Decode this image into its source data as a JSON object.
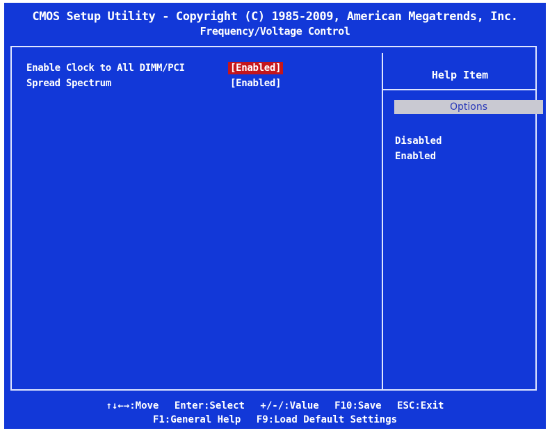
{
  "header": {
    "title": "CMOS Setup Utility - Copyright (C) 1985-2009, American Megatrends, Inc.",
    "subtitle": "Frequency/Voltage Control"
  },
  "settings": [
    {
      "label": "Enable Clock to All DIMM/PCI",
      "value": "[Enabled]",
      "selected": true
    },
    {
      "label": "Spread Spectrum",
      "value": "[Enabled]",
      "selected": false
    }
  ],
  "help": {
    "title": "Help Item",
    "options_header": "Options",
    "options": [
      "Disabled",
      "Enabled"
    ]
  },
  "footer": {
    "row1": [
      {
        "key": "↑↓←→",
        "action": ":Move"
      },
      {
        "key": "Enter",
        "action": ":Select"
      },
      {
        "key": "+/-/",
        "action": ":Value"
      },
      {
        "key": "F10",
        "action": ":Save"
      },
      {
        "key": "ESC",
        "action": ":Exit"
      }
    ],
    "row2": [
      {
        "key": "F1",
        "action": ":General Help"
      },
      {
        "key": "F9",
        "action": ":Load Default Settings"
      }
    ]
  },
  "colors": {
    "background": "#1238d8",
    "selected": "#c4161d",
    "options_header_bg": "#c9c9d2"
  }
}
